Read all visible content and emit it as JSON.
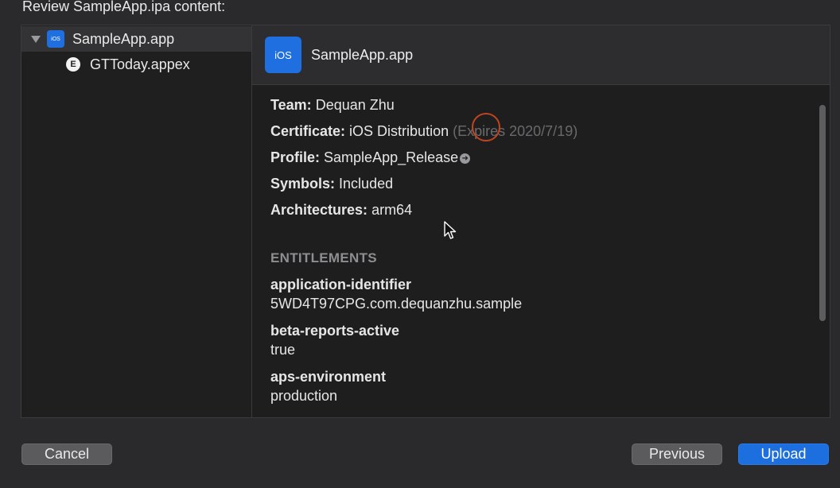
{
  "header": {
    "title": "Review SampleApp.ipa content:"
  },
  "sidebar": {
    "items": [
      {
        "label": "SampleApp.app",
        "badge": "iOS",
        "selected": true
      },
      {
        "label": "GTToday.appex",
        "badge": "E",
        "selected": false
      }
    ]
  },
  "detail": {
    "badge": "iOS",
    "title": "SampleApp.app",
    "team": {
      "label": "Team:",
      "value": "Dequan Zhu"
    },
    "certificate": {
      "label": "Certificate:",
      "value": "iOS Distribution",
      "note": "(Expires 2020/7/19)"
    },
    "profile": {
      "label": "Profile:",
      "value": "SampleApp_Release"
    },
    "symbols": {
      "label": "Symbols:",
      "value": "Included"
    },
    "architectures": {
      "label": "Architectures:",
      "value": "arm64"
    },
    "entitlements_header": "ENTITLEMENTS",
    "entitlements": [
      {
        "key": "application-identifier",
        "value": "5WD4T97CPG.com.dequanzhu.sample"
      },
      {
        "key": "beta-reports-active",
        "value": "true"
      },
      {
        "key": "aps-environment",
        "value": "production"
      }
    ]
  },
  "buttons": {
    "cancel": "Cancel",
    "previous": "Previous",
    "upload": "Upload"
  },
  "colors": {
    "accent": "#1d6fe0",
    "click_ring": "#c0451f"
  }
}
